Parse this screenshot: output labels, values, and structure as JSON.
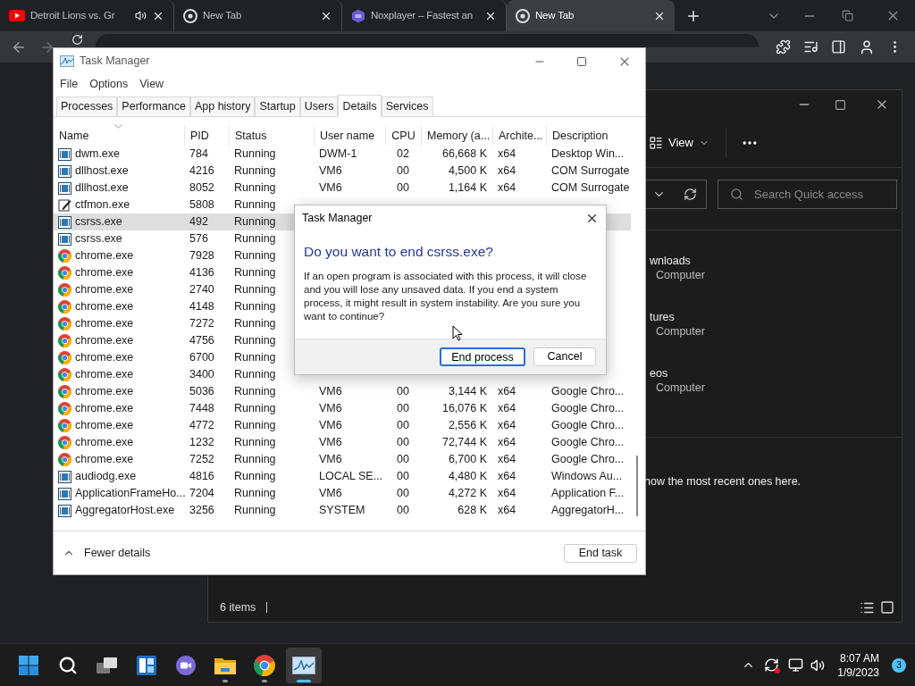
{
  "browser": {
    "tabs": [
      {
        "title": "Detroit Lions vs. Gr",
        "kind": "video",
        "audio": true,
        "selected": false
      },
      {
        "title": "New Tab",
        "kind": "chrome",
        "audio": false,
        "selected": false
      },
      {
        "title": "Noxplayer – Fastest an",
        "kind": "nox",
        "audio": false,
        "selected": false
      },
      {
        "title": "New Tab",
        "kind": "chrome",
        "audio": false,
        "selected": true
      }
    ]
  },
  "explorer": {
    "view": "View",
    "search": {
      "placeholder": "Search Quick access"
    },
    "items": [
      {
        "name": "wnloads",
        "location": "Computer"
      },
      {
        "name": "tures",
        "location": "Computer"
      },
      {
        "name": "eos",
        "location": "Computer"
      }
    ],
    "recent_note": "how the most recent ones here.",
    "status": "6 items"
  },
  "task_manager": {
    "title": "Task Manager",
    "menu": [
      "File",
      "Options",
      "View"
    ],
    "tabs": [
      {
        "label": "Processes",
        "selected": false
      },
      {
        "label": "Performance",
        "selected": false
      },
      {
        "label": "App history",
        "selected": false
      },
      {
        "label": "Startup",
        "selected": false
      },
      {
        "label": "Users",
        "selected": false
      },
      {
        "label": "Details",
        "selected": true
      },
      {
        "label": "Services",
        "selected": false
      }
    ],
    "columns": [
      "Name",
      "PID",
      "Status",
      "User name",
      "CPU",
      "Memory (a...",
      "Archite...",
      "Description"
    ],
    "rows": [
      {
        "kind": "app",
        "name": "dwm.exe",
        "pid": "784",
        "status": "Running",
        "user": "DWM-1",
        "cpu": "02",
        "memory": "66,668 K",
        "arch": "x64",
        "description": "Desktop Win...",
        "selected": false
      },
      {
        "kind": "app",
        "name": "dllhost.exe",
        "pid": "4216",
        "status": "Running",
        "user": "VM6",
        "cpu": "00",
        "memory": "4,500 K",
        "arch": "x64",
        "description": "COM Surrogate",
        "selected": false
      },
      {
        "kind": "app",
        "name": "dllhost.exe",
        "pid": "8052",
        "status": "Running",
        "user": "VM6",
        "cpu": "00",
        "memory": "1,164 K",
        "arch": "x64",
        "description": "COM Surrogate",
        "selected": false
      },
      {
        "kind": "pen",
        "name": "ctfmon.exe",
        "pid": "5808",
        "status": "Running",
        "selected": false
      },
      {
        "kind": "app",
        "name": "csrss.exe",
        "pid": "492",
        "status": "Running",
        "selected": true
      },
      {
        "kind": "app",
        "name": "csrss.exe",
        "pid": "576",
        "status": "Running",
        "selected": false
      },
      {
        "kind": "chrome",
        "name": "chrome.exe",
        "pid": "7928",
        "status": "Running",
        "selected": false
      },
      {
        "kind": "chrome",
        "name": "chrome.exe",
        "pid": "4136",
        "status": "Running",
        "selected": false
      },
      {
        "kind": "chrome",
        "name": "chrome.exe",
        "pid": "2740",
        "status": "Running",
        "selected": false
      },
      {
        "kind": "chrome",
        "name": "chrome.exe",
        "pid": "4148",
        "status": "Running",
        "selected": false
      },
      {
        "kind": "chrome",
        "name": "chrome.exe",
        "pid": "7272",
        "status": "Running",
        "selected": false
      },
      {
        "kind": "chrome",
        "name": "chrome.exe",
        "pid": "4756",
        "status": "Running",
        "selected": false
      },
      {
        "kind": "chrome",
        "name": "chrome.exe",
        "pid": "6700",
        "status": "Running",
        "selected": false
      },
      {
        "kind": "chrome",
        "name": "chrome.exe",
        "pid": "3400",
        "status": "Running",
        "selected": false
      },
      {
        "kind": "chrome",
        "name": "chrome.exe",
        "pid": "5036",
        "status": "Running",
        "user": "VM6",
        "cpu": "00",
        "memory": "3,144 K",
        "arch": "x64",
        "description": "Google Chro...",
        "selected": false
      },
      {
        "kind": "chrome",
        "name": "chrome.exe",
        "pid": "7448",
        "status": "Running",
        "user": "VM6",
        "cpu": "00",
        "memory": "16,076 K",
        "arch": "x64",
        "description": "Google Chro...",
        "selected": false
      },
      {
        "kind": "chrome",
        "name": "chrome.exe",
        "pid": "4772",
        "status": "Running",
        "user": "VM6",
        "cpu": "00",
        "memory": "2,556 K",
        "arch": "x64",
        "description": "Google Chro...",
        "selected": false
      },
      {
        "kind": "chrome",
        "name": "chrome.exe",
        "pid": "1232",
        "status": "Running",
        "user": "VM6",
        "cpu": "00",
        "memory": "72,744 K",
        "arch": "x64",
        "description": "Google Chro...",
        "selected": false
      },
      {
        "kind": "chrome",
        "name": "chrome.exe",
        "pid": "7252",
        "status": "Running",
        "user": "VM6",
        "cpu": "00",
        "memory": "6,700 K",
        "arch": "x64",
        "description": "Google Chro...",
        "selected": false
      },
      {
        "kind": "app",
        "name": "audiodg.exe",
        "pid": "4816",
        "status": "Running",
        "user": "LOCAL SE...",
        "cpu": "00",
        "memory": "4,480 K",
        "arch": "x64",
        "description": "Windows Au...",
        "selected": false
      },
      {
        "kind": "app",
        "name": "ApplicationFrameHo...",
        "pid": "7204",
        "status": "Running",
        "user": "VM6",
        "cpu": "00",
        "memory": "4,272 K",
        "arch": "x64",
        "description": "Application F...",
        "selected": false
      },
      {
        "kind": "app",
        "name": "AggregatorHost.exe",
        "pid": "3256",
        "status": "Running",
        "user": "SYSTEM",
        "cpu": "00",
        "memory": "628 K",
        "arch": "x64",
        "description": "AggregatorH...",
        "selected": false
      }
    ],
    "fewer_details": "Fewer details",
    "end_task": "End task"
  },
  "dialog": {
    "title": "Task Manager",
    "heading": "Do you want to end csrss.exe?",
    "message": "If an open program is associated with this process, it will close and you will lose any unsaved data. If you end a system process, it might result in system instability. Are you sure you want to continue?",
    "buttons": [
      {
        "label": "End process",
        "default": true
      },
      {
        "label": "Cancel",
        "default": false
      }
    ]
  },
  "taskbar": {
    "apps": [
      {
        "kind": "start",
        "running": false,
        "selected": false
      },
      {
        "kind": "search",
        "running": false,
        "selected": false
      },
      {
        "kind": "taskview",
        "running": false,
        "selected": false
      },
      {
        "kind": "widgets",
        "running": false,
        "selected": false
      },
      {
        "kind": "chat",
        "running": false,
        "selected": false
      },
      {
        "kind": "files",
        "running": true,
        "selected": false
      },
      {
        "kind": "browser",
        "running": true,
        "selected": false
      },
      {
        "kind": "monitor",
        "running": true,
        "selected": true
      }
    ],
    "time": "8:07 AM",
    "date": "1/9/2023",
    "notifications": "3"
  }
}
